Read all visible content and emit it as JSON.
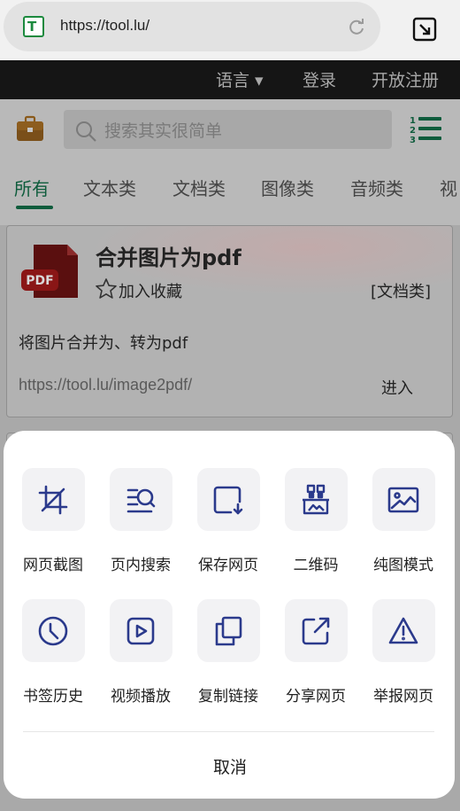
{
  "browser": {
    "url": "https://tool.lu/",
    "favicon_letter": "T",
    "icons": [
      "reload-icon",
      "pip-icon"
    ]
  },
  "topnav": {
    "language": "语言 ▾",
    "login": "登录",
    "register": "开放注册"
  },
  "header": {
    "search_placeholder": "搜索其实很简单",
    "icons": [
      "briefcase-icon",
      "search-icon",
      "numbered-list-icon"
    ]
  },
  "tabs": [
    "所有",
    "文本类",
    "文档类",
    "图像类",
    "音频类",
    "视"
  ],
  "active_tab": 0,
  "card": {
    "title": "合并图片为pdf",
    "favorite": "加入收藏",
    "category": "[文档类]",
    "description": "将图片合并为、转为pdf",
    "url": "https://tool.lu/image2pdf/",
    "enter": "进入",
    "icon_text": "PDF"
  },
  "sheet": {
    "row1": [
      {
        "label": "网页截图",
        "icon": "crop-icon"
      },
      {
        "label": "页内搜索",
        "icon": "find-in-page-icon"
      },
      {
        "label": "保存网页",
        "icon": "save-page-icon"
      },
      {
        "label": "二维码",
        "icon": "qrcode-icon"
      },
      {
        "label": "纯图模式",
        "icon": "image-mode-icon"
      }
    ],
    "row2": [
      {
        "label": "书签历史",
        "icon": "history-icon"
      },
      {
        "label": "视频播放",
        "icon": "video-play-icon"
      },
      {
        "label": "复制链接",
        "icon": "copy-link-icon"
      },
      {
        "label": "分享网页",
        "icon": "share-icon"
      },
      {
        "label": "举报网页",
        "icon": "report-icon"
      }
    ],
    "cancel": "取消"
  },
  "colors": {
    "accent_green": "#0e5c3c",
    "icon_navy": "#2b3a8c",
    "scrim": "#a9a9a9"
  }
}
